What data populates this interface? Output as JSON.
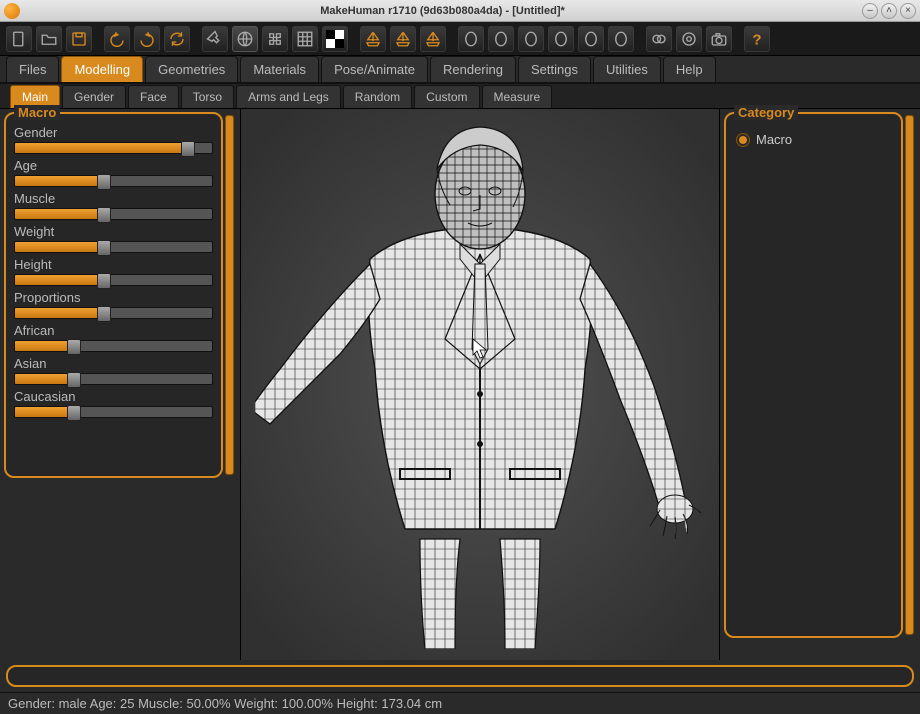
{
  "window": {
    "title": "MakeHuman r1710 (9d63b080a4da) - [Untitled]*"
  },
  "toolbar_icons": [
    "file-icon",
    "open-icon",
    "save-icon",
    "undo-icon",
    "redo-icon",
    "refresh-icon",
    "pin-icon",
    "globe-icon",
    "puzzle-icon",
    "grid-icon",
    "checker-icon",
    "boat1-icon",
    "boat2-icon",
    "boat3-icon",
    "head-front-icon",
    "head-side-icon",
    "head-top1-icon",
    "head-top2-icon",
    "head-top3-icon",
    "head-top4-icon",
    "blobs-icon",
    "target-icon",
    "camera-icon",
    "help-icon"
  ],
  "tabs": [
    "Files",
    "Modelling",
    "Geometries",
    "Materials",
    "Pose/Animate",
    "Rendering",
    "Settings",
    "Utilities",
    "Help"
  ],
  "tabs_active": "Modelling",
  "subtabs": [
    "Main",
    "Gender",
    "Face",
    "Torso",
    "Arms and Legs",
    "Random",
    "Custom",
    "Measure"
  ],
  "subtabs_active": "Main",
  "left": {
    "title": "Macro",
    "sliders": [
      {
        "label": "Gender",
        "value": 88
      },
      {
        "label": "Age",
        "value": 45
      },
      {
        "label": "Muscle",
        "value": 45
      },
      {
        "label": "Weight",
        "value": 45
      },
      {
        "label": "Height",
        "value": 45
      },
      {
        "label": "Proportions",
        "value": 45
      },
      {
        "label": "African",
        "value": 30
      },
      {
        "label": "Asian",
        "value": 30
      },
      {
        "label": "Caucasian",
        "value": 30
      }
    ]
  },
  "right": {
    "title": "Category",
    "items": [
      {
        "label": "Macro",
        "checked": true
      }
    ]
  },
  "status": "Gender: male Age: 25 Muscle: 50.00% Weight: 100.00% Height: 173.04 cm"
}
